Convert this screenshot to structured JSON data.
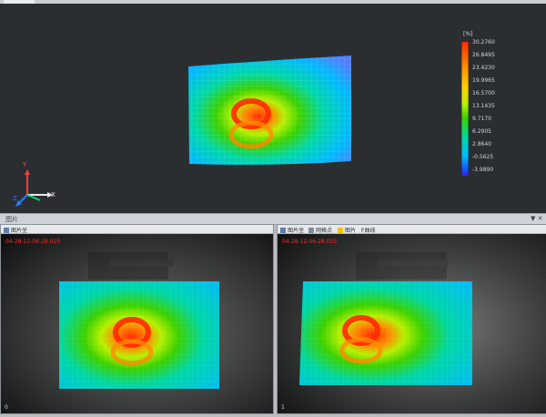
{
  "app": {
    "divider_title": "图片",
    "divider_controls": "▼ ✕"
  },
  "main_view": {
    "legend": {
      "unit": "[%]",
      "values": [
        "30.2760",
        "26.8495",
        "23.4230",
        "19.9965",
        "16.5700",
        "13.1435",
        "9.7170",
        "6.2905",
        "2.8640",
        "-0.5625",
        "-3.9890"
      ],
      "colors": {
        "top": "#ff2a00",
        "upper": "#ff8a00",
        "mid": "#b7f000",
        "lower": "#00d7a7",
        "bottom": "#1f2bff"
      }
    },
    "axes": {
      "x_label": "X",
      "y_label": "Y",
      "z_label": "Z"
    }
  },
  "panels": {
    "left": {
      "toolbar": {
        "image_label": "图片坐"
      },
      "timestamp": "04-28-12-06-28.025",
      "index": "0"
    },
    "right": {
      "toolbar": {
        "image_label": "图片坐",
        "grid_label": "网格点",
        "picture_label": "图片",
        "curve_label": "F曲线"
      },
      "timestamp": "04-28-12-06-28.025",
      "index": "1"
    }
  }
}
